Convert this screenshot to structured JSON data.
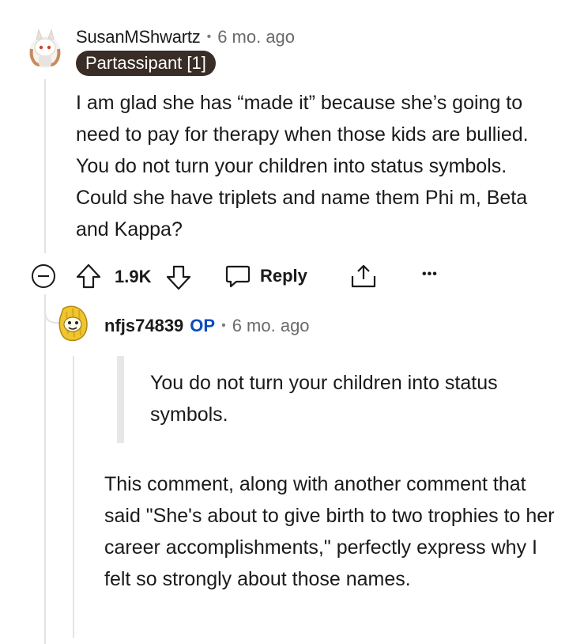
{
  "comment": {
    "username": "SusanMShwartz",
    "separator": "•",
    "time": "6 mo. ago",
    "flair": "Partassipant [1]",
    "body": "I am glad she has “made it” because she’s going to need to pay for therapy when those kids are bullied. You do not turn your children into status symbols. Could she have triplets and name them Phi m, Beta and Kappa?",
    "actions": {
      "vote_count": "1.9K",
      "reply_label": "Reply",
      "more_label": "•••"
    }
  },
  "reply": {
    "username": "nfjs74839",
    "op_badge": "OP",
    "separator": "•",
    "time": "6 mo. ago",
    "quote": "You do not turn your children into status symbols.",
    "body": "This comment, along with another comment that said \"She's about to give birth to two trophies to her career accomplishments,\" perfectly express why I felt so strongly about those names."
  },
  "colors": {
    "flair_bg": "#3a2d27",
    "op_color": "#0a4bbf",
    "thread_line": "#e3e3e3"
  }
}
